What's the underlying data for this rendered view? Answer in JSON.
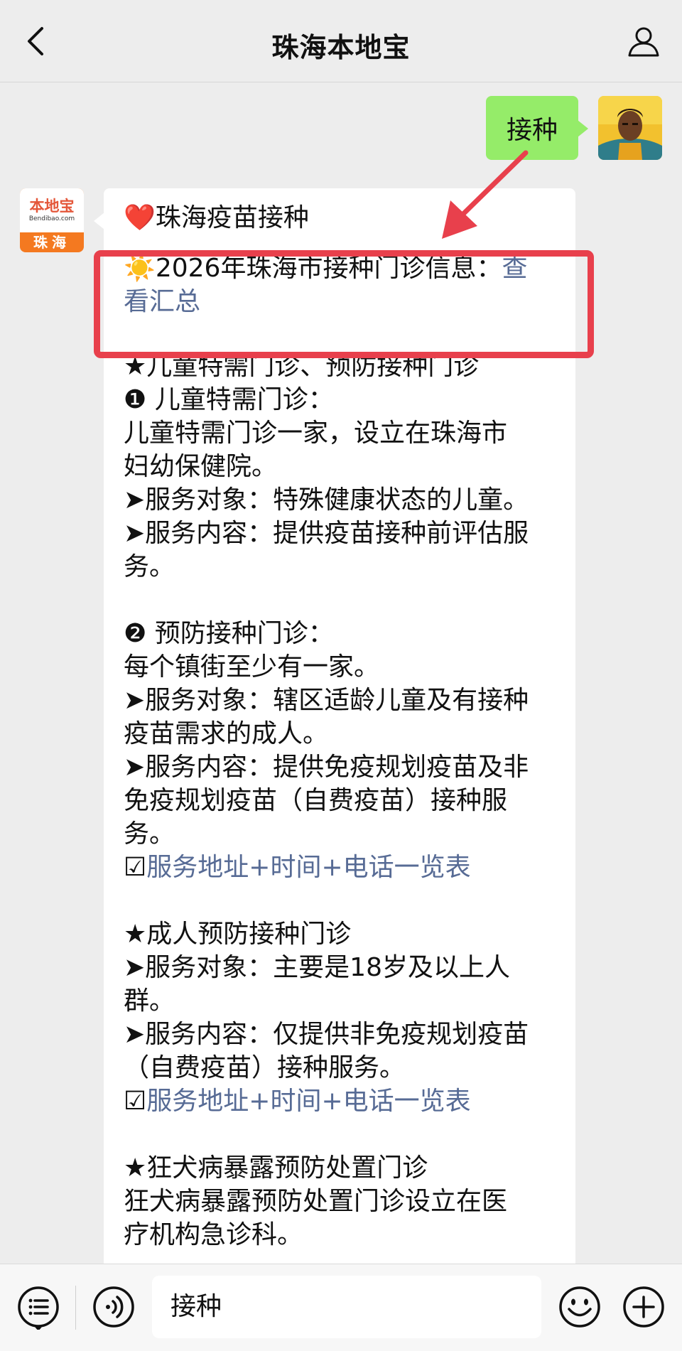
{
  "header": {
    "title": "珠海本地宝"
  },
  "chat": {
    "user_message": "接种",
    "bot_avatar": {
      "brand": "本地宝",
      "domain": "Bendibao.com",
      "city": "珠海"
    },
    "bot_message": {
      "title": "❤️珠海疫苗接种",
      "summary_prefix": "☀️2026年珠海市接种门诊信息：",
      "summary_link_line1": "查",
      "summary_link_line2": "看汇总",
      "section1_heading": "★儿童特需门诊、预防接种门诊",
      "s1_item1_title": "❶ 儿童特需门诊：",
      "s1_item1_desc1": "儿童特需门诊一家，设立在珠海市",
      "s1_item1_desc2": "妇幼保健院。",
      "s1_item1_target": "➤服务对象：特殊健康状态的儿童。",
      "s1_item1_content1": "➤服务内容：提供疫苗接种前评估服",
      "s1_item1_content2": "务。",
      "s1_item2_title": "❷ 预防接种门诊：",
      "s1_item2_desc": "每个镇街至少有一家。",
      "s1_item2_target1": "➤服务对象：辖区适龄儿童及有接种",
      "s1_item2_target2": "疫苗需求的成人。",
      "s1_item2_content1": "➤服务内容：提供免疫规划疫苗及非",
      "s1_item2_content2": "免疫规划疫苗（自费疫苗）接种服",
      "s1_item2_content3": "务。",
      "s1_link_check": "☑",
      "s1_link": "服务地址+时间+电话一览表",
      "section2_heading": "★成人预防接种门诊",
      "s2_target1": "➤服务对象：主要是18岁及以上人",
      "s2_target2": "群。",
      "s2_content1": "➤服务内容：仅提供非免疫规划疫苗",
      "s2_content2": "（自费疫苗）接种服务。",
      "s2_link_check": "☑",
      "s2_link": "服务地址+时间+电话一览表",
      "section3_heading": "★狂犬病暴露预防处置门诊",
      "s3_desc1": "狂犬病暴露预防处置门诊设立在医",
      "s3_desc2": "疗机构急诊科。"
    }
  },
  "input_bar": {
    "value": "接种"
  },
  "colors": {
    "background": "#ededed",
    "user_bubble": "#95ec69",
    "link": "#576b95",
    "highlight": "#e8404c"
  },
  "icons": [
    "back-arrow-icon",
    "profile-icon",
    "menu-list-icon",
    "voice-icon",
    "emoji-icon",
    "plus-icon"
  ]
}
